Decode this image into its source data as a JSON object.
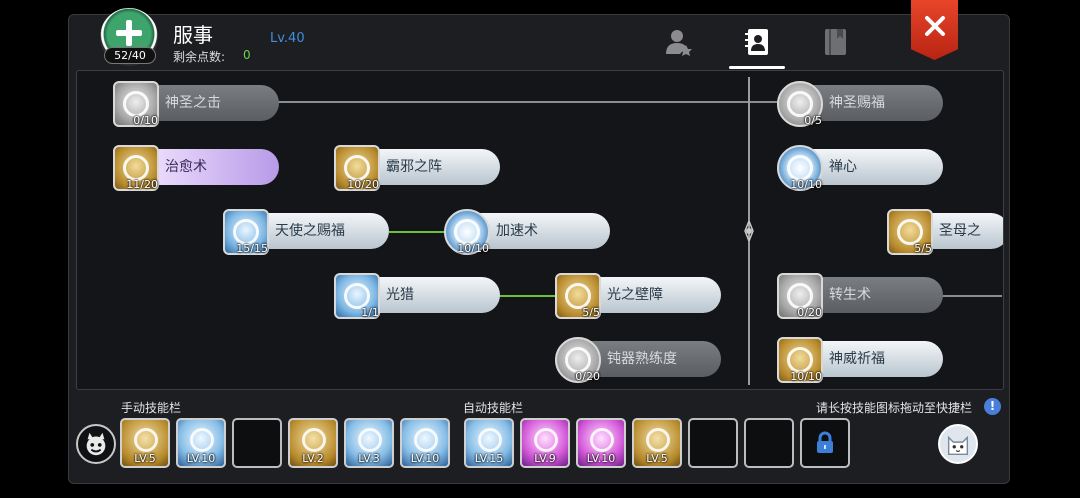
{
  "header": {
    "emblem_count": "52/40",
    "class_name": "服事",
    "points_label": "剩余点数:",
    "points_value": "0",
    "level": "Lv.40"
  },
  "tabs": [
    {
      "name": "character-tab",
      "icon": "person-star-icon",
      "active": false
    },
    {
      "name": "skills-tab",
      "icon": "skill-book-icon",
      "active": true
    },
    {
      "name": "book-tab",
      "icon": "book-icon",
      "active": false
    }
  ],
  "skills": [
    {
      "label": "神圣之击",
      "count": "0/10",
      "state": "dim"
    },
    {
      "label": "治愈术",
      "count": "11/20",
      "state": "purple"
    },
    {
      "label": "霸邪之阵",
      "count": "10/20",
      "state": "silver"
    },
    {
      "label": "天使之赐福",
      "count": "15/15",
      "state": "silver"
    },
    {
      "label": "加速术",
      "count": "10/10",
      "state": "silver"
    },
    {
      "label": "光猎",
      "count": "1/1",
      "state": "silver"
    },
    {
      "label": "光之壁障",
      "count": "5/5",
      "state": "silver"
    },
    {
      "label": "钝器熟练度",
      "count": "0/20",
      "state": "dim"
    },
    {
      "label": "神圣赐福",
      "count": "0/5",
      "state": "dim"
    },
    {
      "label": "禅心",
      "count": "10/10",
      "state": "silver"
    },
    {
      "label": "圣母之",
      "count": "5/5",
      "state": "silver"
    },
    {
      "label": "转生术",
      "count": "0/20",
      "state": "dim"
    },
    {
      "label": "神威祈福",
      "count": "10/10",
      "state": "silver"
    }
  ],
  "manual_bar": {
    "label": "手动技能栏",
    "slots": [
      {
        "lv": "LV.5",
        "color": "gold",
        "icon": "shield-burst-icon"
      },
      {
        "lv": "LV.10",
        "color": "blue",
        "icon": "wave-icon"
      },
      {
        "lv": "",
        "color": "empty",
        "icon": ""
      },
      {
        "lv": "LV.2",
        "color": "gold",
        "icon": "sword-icon"
      },
      {
        "lv": "LV.3",
        "color": "blue",
        "icon": "angel-halo-icon"
      },
      {
        "lv": "LV.10",
        "color": "blue",
        "icon": "wings-icon"
      }
    ]
  },
  "auto_bar": {
    "label": "自动技能栏",
    "slots": [
      {
        "lv": "LV.15",
        "color": "blue",
        "icon": "blessing-icon"
      },
      {
        "lv": "LV.9",
        "color": "pink",
        "icon": "spark-icon"
      },
      {
        "lv": "LV.10",
        "color": "pink",
        "icon": "magic-icon"
      },
      {
        "lv": "LV.5",
        "color": "gold",
        "icon": "skull-icon"
      },
      {
        "lv": "",
        "color": "empty",
        "icon": ""
      },
      {
        "lv": "",
        "color": "empty",
        "icon": ""
      },
      {
        "lv": "",
        "color": "locked",
        "icon": "lock-icon"
      }
    ]
  },
  "hint": "请长按技能图标拖动至快捷栏",
  "colors": {
    "accent_green": "#6ac23a",
    "level_blue": "#3f8fdc",
    "close_red": "#d8351d"
  }
}
